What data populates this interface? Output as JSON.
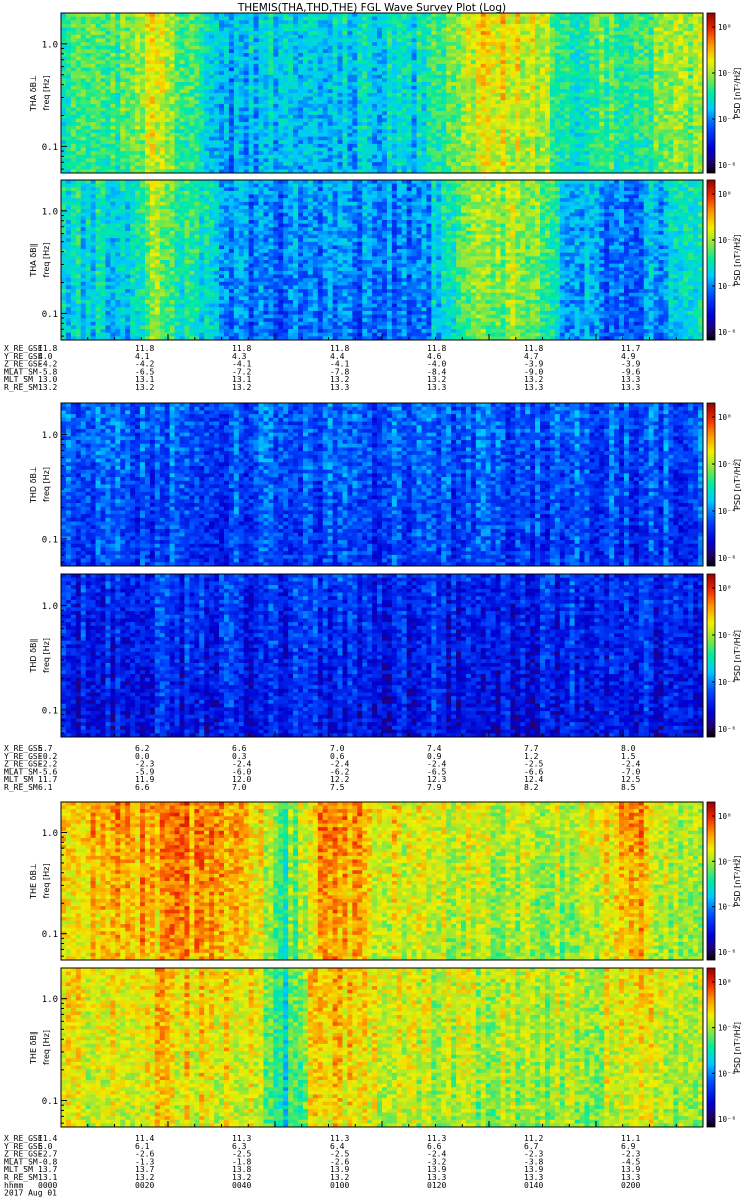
{
  "title": "THEMIS(THA,THD,THE) FGL Wave Survey Plot (Log)",
  "colorbar_label": "PSD [nT²/Hz]",
  "colorbar_ticks": [
    "10⁰",
    "10⁻²",
    "10⁻⁴",
    "10⁻⁶"
  ],
  "time_axis": {
    "labels": [
      "hhmm",
      "2017 Aug 01"
    ],
    "ticks": [
      "0000",
      "0020",
      "0040",
      "0100",
      "0120",
      "0140",
      "0200"
    ]
  },
  "chart_data": [
    {
      "type": "heatmap",
      "probe": "THA",
      "panels": [
        {
          "ylabel": "THA δB⊥",
          "yunit": "freq [Hz]",
          "ytick_labels": [
            "1.0",
            "0.1"
          ],
          "yscale": "log",
          "ylim_hz": [
            0.055,
            2.0
          ],
          "intensity_profile": [
            0.55,
            0.55,
            0.56,
            0.72,
            0.55,
            0.4,
            0.42,
            0.44,
            0.43,
            0.45,
            0.46,
            0.45,
            0.6,
            0.7,
            0.72,
            0.65,
            0.5,
            0.55,
            0.55,
            0.6,
            0.62
          ]
        },
        {
          "ylabel": "THA δB∥",
          "yunit": "freq [Hz]",
          "ytick_labels": [
            "1.0",
            "0.1"
          ],
          "yscale": "log",
          "ylim_hz": [
            0.055,
            2.0
          ],
          "intensity_profile": [
            0.45,
            0.48,
            0.45,
            0.65,
            0.5,
            0.4,
            0.36,
            0.34,
            0.35,
            0.36,
            0.35,
            0.33,
            0.5,
            0.62,
            0.65,
            0.55,
            0.4,
            0.36,
            0.36,
            0.42,
            0.5
          ]
        }
      ],
      "ephemeris": {
        "labels": [
          "X_RE_GSE",
          "Y_RE_GSE",
          "Z_RE_GSE",
          "MLAT_SM",
          "MLT_SM",
          "R_RE_SM"
        ],
        "rows": [
          [
            "11.8",
            "11.8",
            "11.8",
            "11.8",
            "11.8",
            "11.8",
            "11.7"
          ],
          [
            "4.0",
            "4.1",
            "4.3",
            "4.4",
            "4.6",
            "4.7",
            "4.9"
          ],
          [
            "-4.2",
            "-4.2",
            "-4.1",
            "-4.1",
            "-4.0",
            "-3.9",
            "-3.9"
          ],
          [
            "-5.8",
            "-6.5",
            "-7.2",
            "-7.8",
            "-8.4",
            "-9.0",
            "-9.6"
          ],
          [
            "13.0",
            "13.1",
            "13.1",
            "13.2",
            "13.2",
            "13.2",
            "13.3"
          ],
          [
            "13.2",
            "13.2",
            "13.2",
            "13.3",
            "13.3",
            "13.3",
            "13.3"
          ]
        ]
      }
    },
    {
      "type": "heatmap",
      "probe": "THD",
      "panels": [
        {
          "ylabel": "THD δB⊥",
          "yunit": "freq [Hz]",
          "ytick_labels": [
            "1.0",
            "0.1"
          ],
          "yscale": "log",
          "ylim_hz": [
            0.055,
            2.0
          ],
          "intensity_profile": [
            0.3,
            0.3,
            0.3,
            0.3,
            0.3,
            0.3,
            0.3,
            0.3,
            0.3,
            0.3,
            0.3,
            0.3,
            0.3,
            0.3,
            0.3,
            0.3,
            0.3,
            0.3,
            0.3,
            0.3,
            0.3
          ]
        },
        {
          "ylabel": "THD δB∥",
          "yunit": "freq [Hz]",
          "ytick_labels": [
            "1.0",
            "0.1"
          ],
          "yscale": "log",
          "ylim_hz": [
            0.055,
            2.0
          ],
          "intensity_profile": [
            0.24,
            0.24,
            0.24,
            0.24,
            0.24,
            0.24,
            0.24,
            0.24,
            0.24,
            0.24,
            0.24,
            0.24,
            0.24,
            0.24,
            0.24,
            0.24,
            0.24,
            0.24,
            0.24,
            0.24,
            0.24
          ]
        }
      ],
      "ephemeris": {
        "labels": [
          "X_RE_GSE",
          "Y_RE_GSE",
          "Z_RE_GSE",
          "MLAT_SM",
          "MLT_SM",
          "R_RE_SM"
        ],
        "rows": [
          [
            "5.7",
            "6.2",
            "6.6",
            "7.0",
            "7.4",
            "7.7",
            "8.0"
          ],
          [
            "-0.2",
            "0.0",
            "0.3",
            "0.6",
            "0.9",
            "1.2",
            "1.5"
          ],
          [
            "-2.2",
            "-2.3",
            "-2.4",
            "-2.4",
            "-2.4",
            "-2.5",
            "-2.4"
          ],
          [
            "-5.6",
            "-5.9",
            "-6.0",
            "-6.2",
            "-6.5",
            "-6.6",
            "-7.0"
          ],
          [
            "11.7",
            "11.9",
            "12.0",
            "12.2",
            "12.3",
            "12.4",
            "12.5"
          ],
          [
            "6.1",
            "6.6",
            "7.0",
            "7.5",
            "7.9",
            "8.2",
            "8.5"
          ]
        ]
      }
    },
    {
      "type": "heatmap",
      "probe": "THE",
      "panels": [
        {
          "ylabel": "THE δB⊥",
          "yunit": "freq [Hz]",
          "ytick_labels": [
            "1.0",
            "0.1"
          ],
          "yscale": "log",
          "ylim_hz": [
            0.055,
            2.0
          ],
          "intensity_profile": [
            0.78,
            0.78,
            0.8,
            0.8,
            0.82,
            0.82,
            0.75,
            0.55,
            0.8,
            0.8,
            0.72,
            0.7,
            0.68,
            0.66,
            0.66,
            0.66,
            0.66,
            0.7,
            0.8,
            0.66,
            0.64
          ]
        },
        {
          "ylabel": "THE δB∥",
          "yunit": "freq [Hz]",
          "ytick_labels": [
            "1.0",
            "0.1"
          ],
          "yscale": "log",
          "ylim_hz": [
            0.055,
            2.0
          ],
          "intensity_profile": [
            0.72,
            0.72,
            0.72,
            0.74,
            0.74,
            0.73,
            0.7,
            0.5,
            0.75,
            0.74,
            0.7,
            0.68,
            0.66,
            0.66,
            0.66,
            0.66,
            0.66,
            0.68,
            0.75,
            0.66,
            0.64
          ]
        }
      ],
      "ephemeris": {
        "labels": [
          "X_RE_GSE",
          "Y_RE_GSE",
          "Z_RE_GSE",
          "MLAT_SM",
          "MLT_SM",
          "R_RE_SM"
        ],
        "rows": [
          [
            "11.4",
            "11.4",
            "11.3",
            "11.3",
            "11.3",
            "11.2",
            "11.1"
          ],
          [
            "6.0",
            "6.1",
            "6.3",
            "6.4",
            "6.6",
            "6.7",
            "6.9"
          ],
          [
            "-2.7",
            "-2.6",
            "-2.5",
            "-2.5",
            "-2.4",
            "-2.3",
            "-2.3"
          ],
          [
            "-0.8",
            "-1.3",
            "-1.8",
            "-2.6",
            "-3.2",
            "-3.8",
            "-4.5"
          ],
          [
            "13.7",
            "13.7",
            "13.8",
            "13.9",
            "13.9",
            "13.9",
            "13.9"
          ],
          [
            "13.1",
            "13.2",
            "13.2",
            "13.2",
            "13.3",
            "13.3",
            "13.3"
          ]
        ]
      }
    }
  ]
}
